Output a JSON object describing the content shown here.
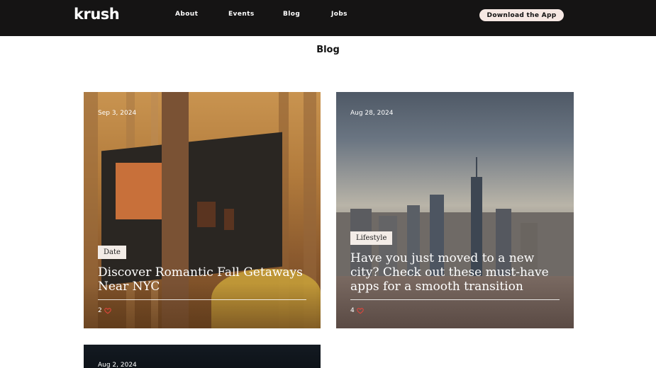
{
  "header": {
    "logo": "krush",
    "nav": [
      "About",
      "Events",
      "Blog",
      "Jobs"
    ],
    "cta": "Download the App"
  },
  "page": {
    "title": "Blog"
  },
  "posts": [
    {
      "date": "Sep 3, 2024",
      "tag": "Date",
      "title": "Discover Romantic Fall Getaways Near NYC",
      "likes": "2"
    },
    {
      "date": "Aug 28, 2024",
      "tag": "Lifestyle",
      "title": "Have you just moved to a new city? Check out these must-have apps for a smooth transition",
      "likes": "4"
    },
    {
      "date": "Aug 2, 2024"
    }
  ],
  "colors": {
    "header_bg": "#151414",
    "cta_bg": "#f6e8e3",
    "heart": "#e0453b"
  }
}
